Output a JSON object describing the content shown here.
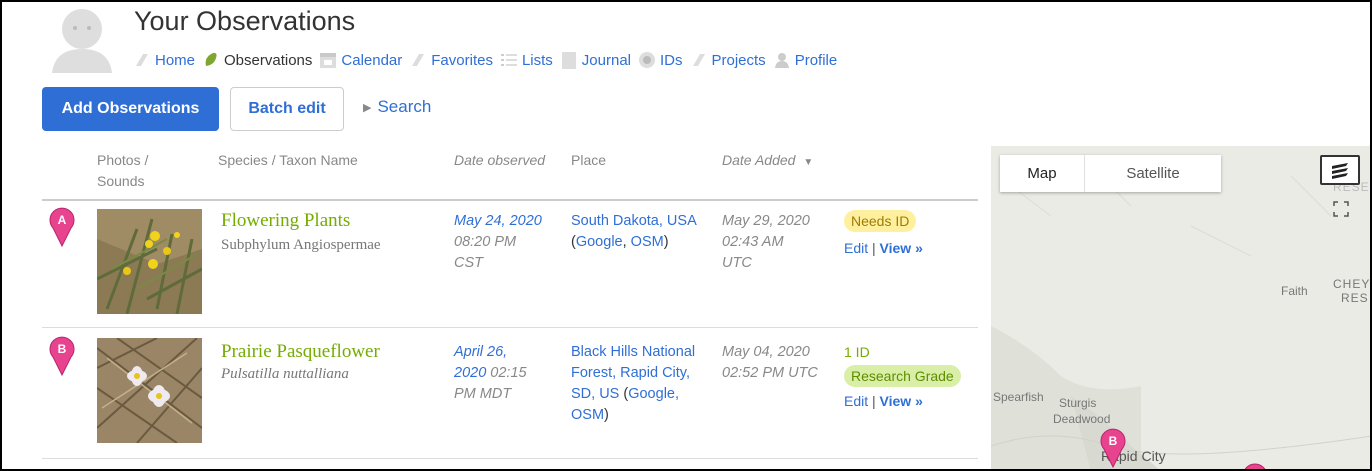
{
  "header": {
    "title": "Your Observations",
    "nav": [
      {
        "label": "Home",
        "icon": "home-icon"
      },
      {
        "label": "Observations",
        "icon": "observations-icon"
      },
      {
        "label": "Calendar",
        "icon": "calendar-icon"
      },
      {
        "label": "Favorites",
        "icon": "favorites-icon"
      },
      {
        "label": "Lists",
        "icon": "lists-icon"
      },
      {
        "label": "Journal",
        "icon": "journal-icon"
      },
      {
        "label": "IDs",
        "icon": "ids-icon"
      },
      {
        "label": "Projects",
        "icon": "projects-icon"
      },
      {
        "label": "Profile",
        "icon": "profile-icon"
      }
    ]
  },
  "actions": {
    "add_label": "Add Observations",
    "batch_label": "Batch edit",
    "search_label": "Search"
  },
  "table": {
    "headers": {
      "photos_line1": "Photos /",
      "photos_line2": "Sounds",
      "species": "Species / Taxon Name",
      "date_observed": "Date observed",
      "place": "Place",
      "date_added": "Date Added"
    },
    "rows": [
      {
        "marker": "A",
        "common_name": "Flowering Plants",
        "scientific_name": "Subphylum Angiospermae",
        "date_obs_line1": "May 24, 2020",
        "date_obs_line2": "08:20 PM",
        "date_obs_line3": "CST",
        "place_line1": "South Dakota, USA",
        "place_google": "Google",
        "place_osm": "OSM",
        "added_line1": "May 29, 2020",
        "added_line2": "02:43 AM",
        "added_line3": "UTC",
        "status": "Needs ID",
        "edit": "Edit",
        "view": "View »"
      },
      {
        "marker": "B",
        "common_name": "Prairie Pasqueflower",
        "scientific_name": "Pulsatilla nuttalliana",
        "date_obs_line1": "April 26,",
        "date_obs_line2a": "2020",
        "date_obs_line2b": "02:15",
        "date_obs_line3": "PM MDT",
        "place_line1": "Black Hills National",
        "place_line2": "Forest, Rapid City,",
        "place_line3": "SD, US",
        "place_google": "Google,",
        "place_osm": "OSM",
        "added_line1": "May 04, 2020",
        "added_line2": "02:52 PM UTC",
        "ids": "1 ID",
        "status": "Research Grade",
        "edit": "Edit",
        "view": "View »"
      }
    ]
  },
  "map": {
    "tab_map": "Map",
    "tab_satellite": "Satellite",
    "labels": [
      "Faith",
      "CHEY",
      "RES",
      "Spearfish",
      "Sturgis",
      "Deadwood",
      "Rapid City",
      "RESE"
    ],
    "markers": [
      "B"
    ]
  },
  "colors": {
    "accent": "#2f6fd5",
    "taxon_green": "#74ac00",
    "pin_pink": "#e8438f",
    "needs_id_bg": "#fff0a0",
    "research_bg": "#d9efa8"
  }
}
